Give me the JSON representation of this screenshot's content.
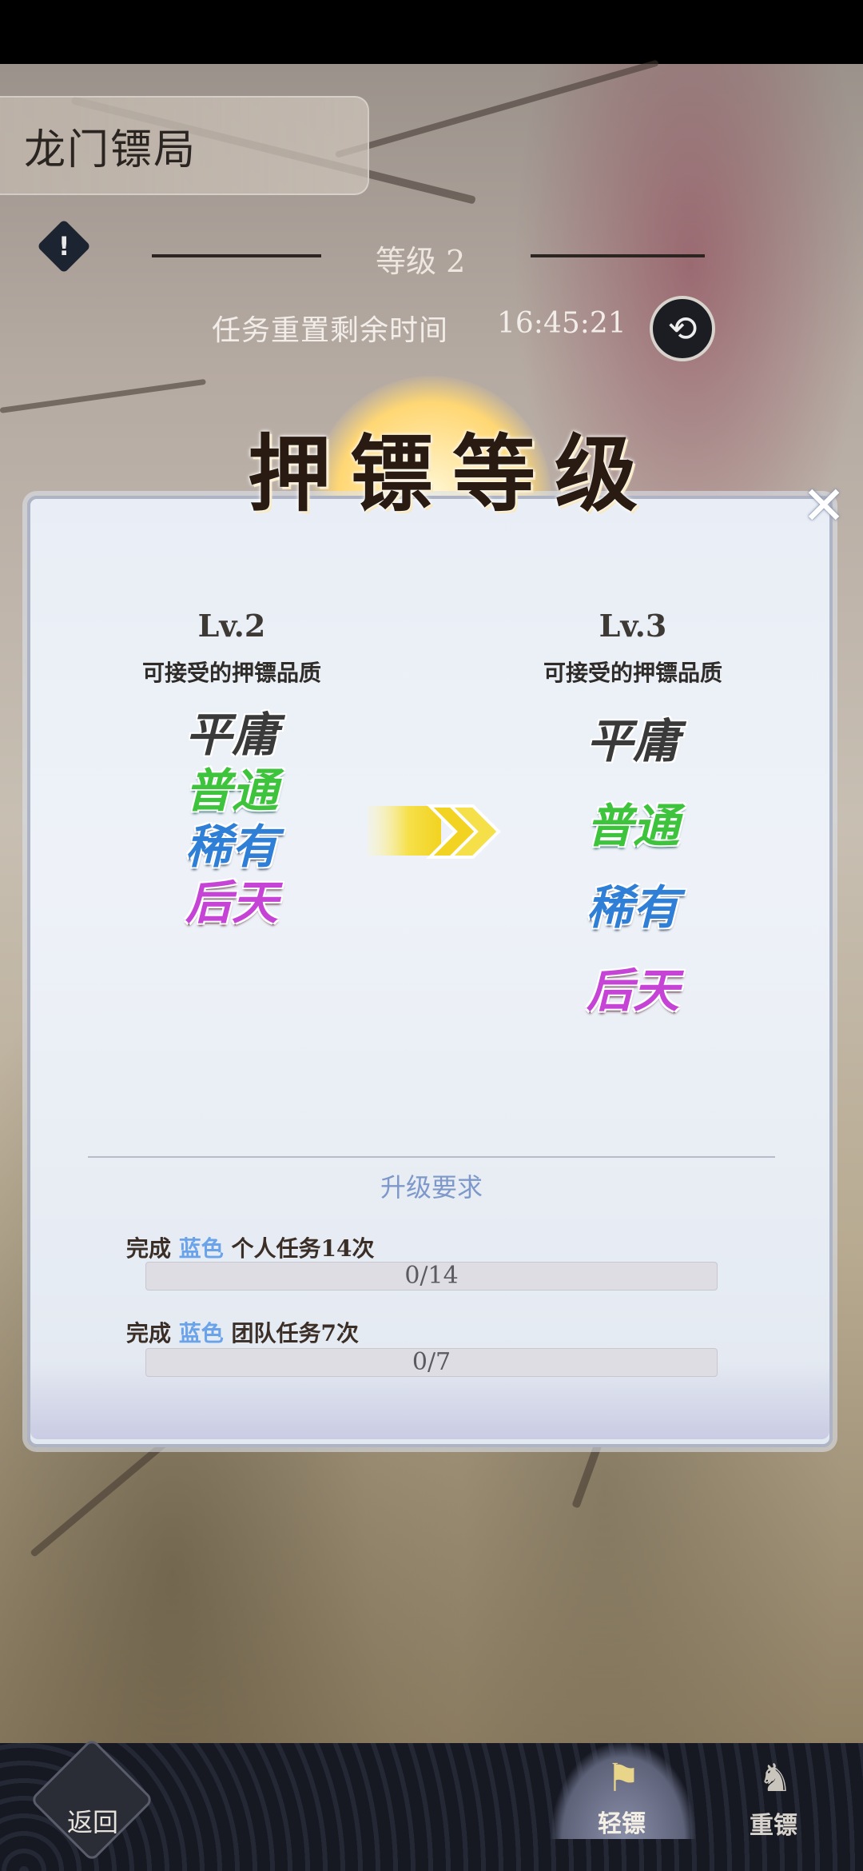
{
  "header": {
    "title": "龙门镖局",
    "level_label": "等级 2",
    "reset_label": "任务重置剩余时间",
    "reset_time": "16:45:21"
  },
  "icons": {
    "info": "info-diamond-icon",
    "refresh": "refresh-icon",
    "close": "close-icon",
    "arrow": "double-chevron-right-icon"
  },
  "dialog": {
    "banner": "押镖等级",
    "current": {
      "level": "Lv.2",
      "subtitle": "可接受的押镖品质",
      "qualities": [
        "平庸",
        "普通",
        "稀有",
        "后天"
      ]
    },
    "next": {
      "level": "Lv.3",
      "subtitle": "可接受的押镖品质",
      "qualities": [
        "平庸",
        "普通",
        "稀有",
        "后天"
      ]
    },
    "requirements": {
      "title": "升级要求",
      "items": [
        {
          "prefix": "完成",
          "color_word": "蓝色",
          "suffix": "个人任务14次",
          "progress_text": "0/14",
          "progress": 0
        },
        {
          "prefix": "完成",
          "color_word": "蓝色",
          "suffix": "团队任务7次",
          "progress_text": "0/7",
          "progress": 0
        }
      ]
    }
  },
  "colors": {
    "quality_common": "#3a3a3a",
    "quality_normal": "#3ec43c",
    "quality_rare": "#2f7fd7",
    "quality_innate": "#c544d6",
    "requirement_accent": "#6aa3ea"
  },
  "bottom_nav": {
    "back": "返回",
    "light_escort": "轻镖",
    "heavy_escort": "重镖"
  }
}
